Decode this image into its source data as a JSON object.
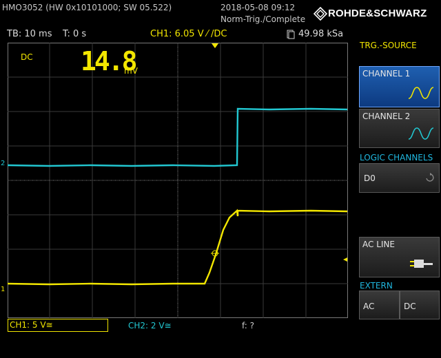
{
  "header": {
    "model": "HMO3052 (HW 0x10101000; SW 05.522)",
    "datetime": "2018-05-08 09:12",
    "trigger_status": "Norm-Trig./Complete",
    "brand": "ROHDE&SCHWARZ"
  },
  "topbar": {
    "timebase": "TB: 10 ms",
    "trigger_time": "T: 0 s",
    "trigger_level": "CH1: 6.05 V ⁄ /DC",
    "sample_rate": "49.98 kSa"
  },
  "display": {
    "coupling": "DC",
    "big_value": "14.8",
    "big_unit": "mV",
    "ch1_marker": "1",
    "ch2_marker": "2"
  },
  "side_menu": {
    "title": "TRG.-SOURCE",
    "channel1": "CHANNEL 1",
    "channel2": "CHANNEL 2",
    "logic_header": "LOGIC CHANNELS",
    "d0": "D0",
    "ac_line": "AC LINE",
    "extern_header": "EXTERN",
    "ac": "AC",
    "dc": "DC"
  },
  "bottom": {
    "ch1_scale": "CH1: 5 V≅",
    "ch2_scale": "CH2: 2 V≅",
    "freq": "f: ?"
  },
  "colors": {
    "ch1": "#f2e600",
    "ch2": "#22c8d2",
    "selected_button": "#1f5fb0"
  }
}
